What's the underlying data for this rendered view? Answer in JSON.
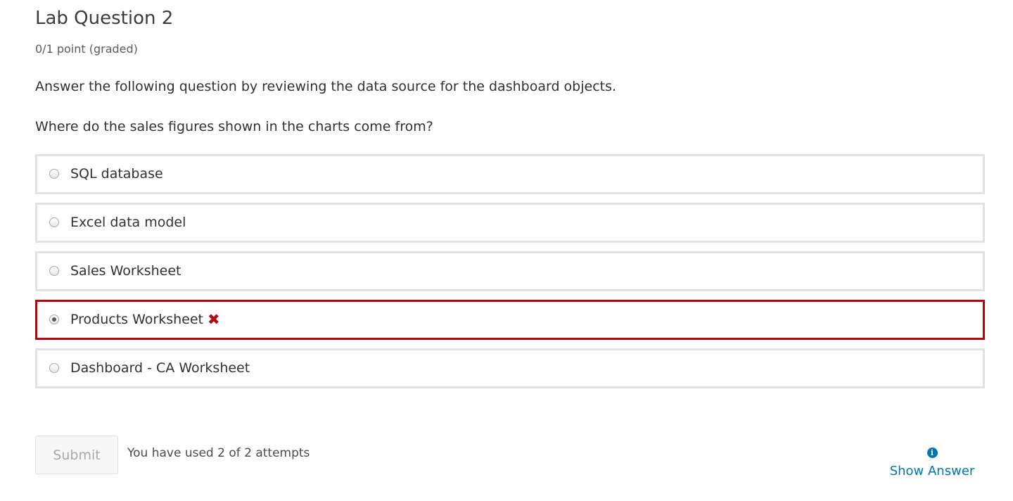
{
  "problem": {
    "title": "Lab Question 2",
    "points": "0/1 point (graded)",
    "instruction": "Answer the following question by reviewing the data source for the dashboard objects.",
    "question": "Where do the sales figures shown in the charts come from?"
  },
  "choices": [
    {
      "label": "SQL database",
      "selected": false
    },
    {
      "label": "Excel data model",
      "selected": false
    },
    {
      "label": "Sales Worksheet",
      "selected": false
    },
    {
      "label": "Products Worksheet",
      "selected": true,
      "status": "incorrect",
      "status_icon": "✖"
    },
    {
      "label": "Dashboard - CA Worksheet",
      "selected": false
    }
  ],
  "actions": {
    "submit_label": "Submit",
    "attempts_text": "You have used 2 of 2 attempts",
    "show_answer_label": "Show Answer",
    "info_icon": "i"
  },
  "colors": {
    "incorrect": "#b20610",
    "link": "#0075b4",
    "border": "#e2e2e2"
  }
}
